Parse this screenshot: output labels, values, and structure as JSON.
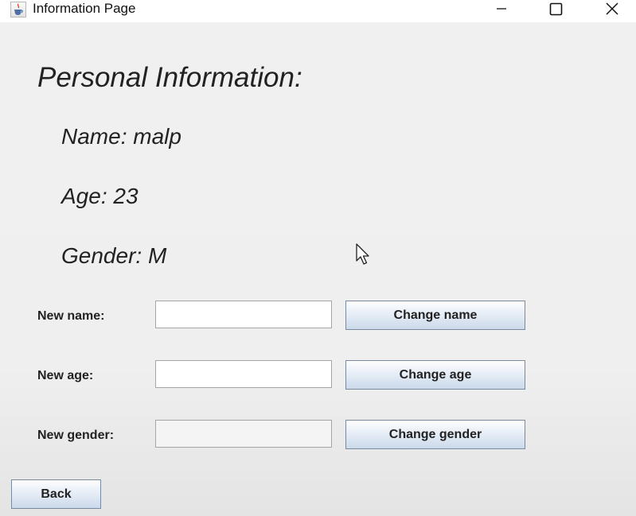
{
  "window": {
    "title": "Information Page",
    "icon": "java-cup-icon"
  },
  "main": {
    "heading": "Personal Information:",
    "name_line": "Name: malp",
    "age_line": "Age: 23",
    "gender_line": "Gender: M"
  },
  "form": {
    "name_label": "New name:",
    "name_value": "",
    "age_label": "New age:",
    "age_value": "",
    "gender_label": "New gender:",
    "gender_value": "",
    "change_name_label": "Change name",
    "change_age_label": "Change age",
    "change_gender_label": "Change gender"
  },
  "footer": {
    "back_label": "Back"
  },
  "colors": {
    "background": "#eeeeee",
    "button_gradient_top": "#fefefe",
    "button_gradient_bottom": "#cbd9ea",
    "button_border": "#7a8a9e"
  }
}
